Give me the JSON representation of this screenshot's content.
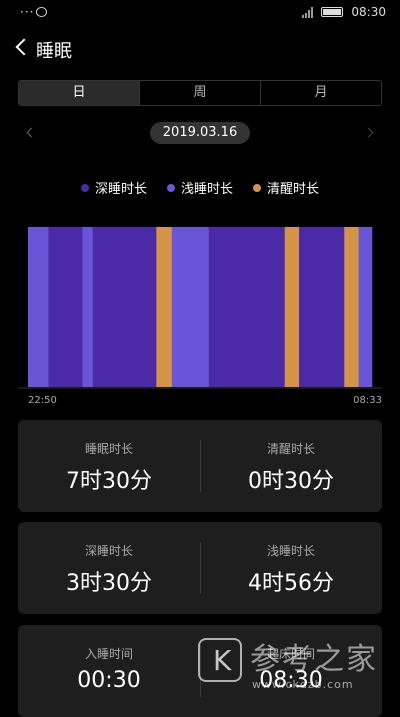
{
  "status_bar": {
    "left_text": "···",
    "time": "08:30"
  },
  "header": {
    "title": "睡眠"
  },
  "tabs": [
    {
      "label": "日",
      "active": true
    },
    {
      "label": "周",
      "active": false
    },
    {
      "label": "月",
      "active": false
    }
  ],
  "date": "2019.03.16",
  "legend": [
    {
      "label": "深睡时长",
      "color": "#4b2aa8"
    },
    {
      "label": "浅睡时长",
      "color": "#6a55d6"
    },
    {
      "label": "清醒时长",
      "color": "#d39448"
    }
  ],
  "colors": {
    "deep": "#4b2aa8",
    "light": "#6a55d6",
    "awake": "#d39448",
    "card_bg": "#1e1e1e"
  },
  "chart_data": {
    "type": "timeline",
    "start_label": "22:50",
    "end_label": "08:33",
    "segments": [
      {
        "stage": "light",
        "weight": 20
      },
      {
        "stage": "deep",
        "weight": 33
      },
      {
        "stage": "light",
        "weight": 10
      },
      {
        "stage": "deep",
        "weight": 62
      },
      {
        "stage": "awake",
        "weight": 15
      },
      {
        "stage": "light",
        "weight": 36
      },
      {
        "stage": "deep",
        "weight": 74
      },
      {
        "stage": "awake",
        "weight": 14
      },
      {
        "stage": "deep",
        "weight": 44
      },
      {
        "stage": "awake",
        "weight": 14
      },
      {
        "stage": "light",
        "weight": 13
      }
    ]
  },
  "cards": [
    {
      "left": {
        "label": "睡眠时长",
        "value": "7时30分"
      },
      "right": {
        "label": "清醒时长",
        "value": "0时30分"
      }
    },
    {
      "left": {
        "label": "深睡时长",
        "value": "3时30分"
      },
      "right": {
        "label": "浅睡时长",
        "value": "4时56分"
      }
    },
    {
      "left": {
        "label": "入睡时间",
        "value": "00:30"
      },
      "right": {
        "label": "起床时间",
        "value": "08:30"
      }
    }
  ],
  "watermark": {
    "letter": "K",
    "text": "参考之家",
    "url": "www.ckdzb.com"
  }
}
